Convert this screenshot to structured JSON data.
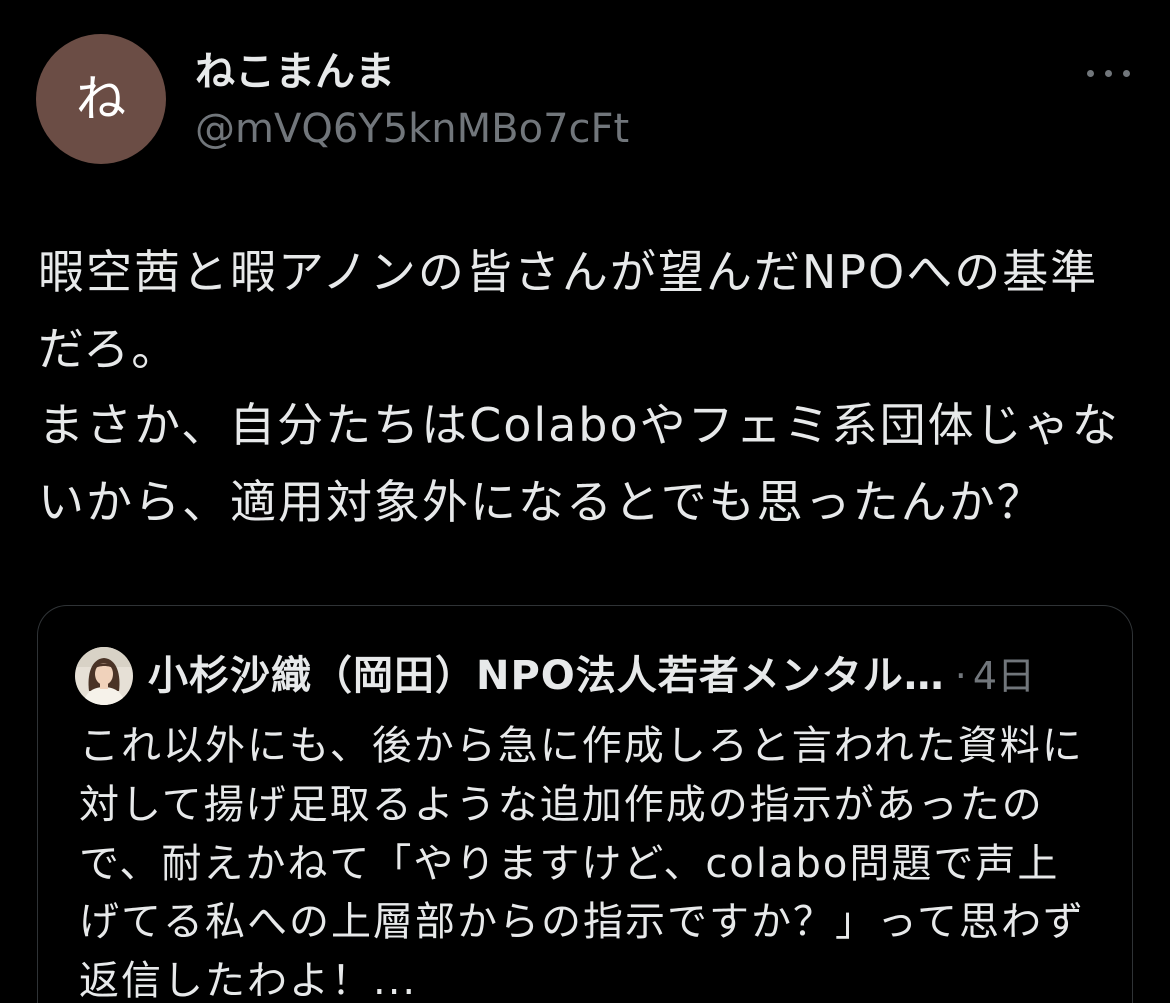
{
  "theme": {
    "background": "#000000",
    "text": "#e7e9ea",
    "secondary_text": "#71767b",
    "border": "#2f3336",
    "avatar": "#6b4d45",
    "avatar_text": "#ffffff"
  },
  "author": {
    "avatar_initial": "ね",
    "display_name": "ねこまんま",
    "handle": "@mVQ6Y5knMBo7cFt"
  },
  "more_menu": {
    "icon": "more-horizontal-icon"
  },
  "tweet": {
    "text_lines": [
      "暇空茜と暇アノンの皆さんが望んだNPOへの基準",
      "だろ。",
      "まさか、自分たちはColaboやフェミ系団体じゃな",
      "いから、適用対象外になるとでも思ったんか？"
    ]
  },
  "quoted_tweet": {
    "author_name": "小杉沙織（岡田）NPO法人若者メンタル…",
    "separator": "·",
    "time": "4日",
    "text_lines": [
      "これ以外にも、後から急に作成しろと言われた資料に",
      "対して揚げ足取るような追加作成の指示があったの",
      "で、耐えかねて「やりますけど、colabo問題で声上",
      "げてる私への上層部からの指示ですか？」って思わず",
      "返信したわよ！..."
    ]
  }
}
